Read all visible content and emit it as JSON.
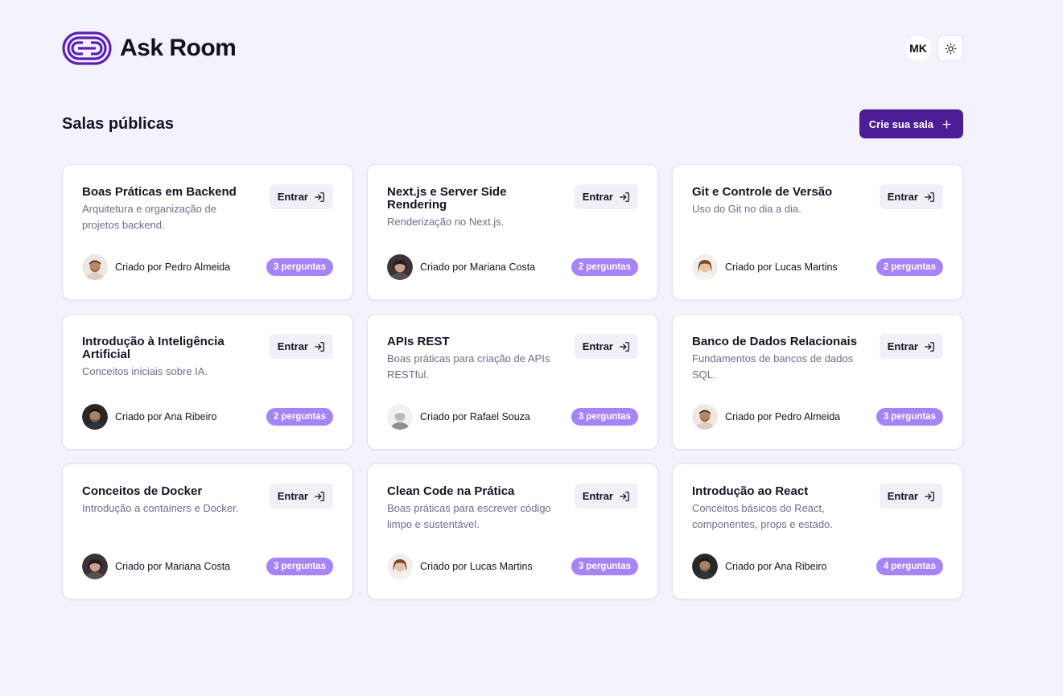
{
  "header": {
    "brand_title": "Ask Room",
    "user_initials": "MK",
    "theme_icon": "sun-icon"
  },
  "section": {
    "title": "Salas públicas",
    "create_label": "Crie sua sala"
  },
  "colors": {
    "background": "#f4f2fd",
    "brand": "#4c1d95",
    "badge": "#a684f7"
  },
  "rooms": [
    {
      "title": "Boas Práticas em Backend",
      "description": "Arquitetura e organização de projetos backend.",
      "enter_label": "Entrar",
      "creator": "Criado por Pedro Almeida",
      "count": "3 perguntas",
      "avatar": "pedro"
    },
    {
      "title": "Next.js e Server Side Rendering",
      "description": "Renderização no Next.js.",
      "enter_label": "Entrar",
      "creator": "Criado por Mariana Costa",
      "count": "2 perguntas",
      "avatar": "mariana"
    },
    {
      "title": "Git e Controle de Versão",
      "description": "Uso do Git no dia a dia.",
      "enter_label": "Entrar",
      "creator": "Criado por Lucas Martins",
      "count": "2 perguntas",
      "avatar": "lucas"
    },
    {
      "title": "Introdução à Inteligência Artificial",
      "description": "Conceitos iniciais sobre IA.",
      "enter_label": "Entrar",
      "creator": "Criado por Ana Ribeiro",
      "count": "2 perguntas",
      "avatar": "ana"
    },
    {
      "title": "APIs REST",
      "description": "Boas práticas para criação de APIs RESTful.",
      "enter_label": "Entrar",
      "creator": "Criado por Rafael Souza",
      "count": "3 perguntas",
      "avatar": "rafael"
    },
    {
      "title": "Banco de Dados Relacionais",
      "description": "Fundamentos de bancos de dados SQL.",
      "enter_label": "Entrar",
      "creator": "Criado por Pedro Almeida",
      "count": "3 perguntas",
      "avatar": "pedro"
    },
    {
      "title": "Conceitos de Docker",
      "description": "Introdução a containers e Docker.",
      "enter_label": "Entrar",
      "creator": "Criado por Mariana Costa",
      "count": "3 perguntas",
      "avatar": "mariana"
    },
    {
      "title": "Clean Code na Prática",
      "description": "Boas práticas para escrever código limpo e sustentável.",
      "enter_label": "Entrar",
      "creator": "Criado por Lucas Martins",
      "count": "3 perguntas",
      "avatar": "lucas"
    },
    {
      "title": "Introdução ao React",
      "description": "Conceitos básicos do React, componentes, props e estado.",
      "enter_label": "Entrar",
      "creator": "Criado por Ana Ribeiro",
      "count": "4 perguntas",
      "avatar": "ana"
    }
  ]
}
